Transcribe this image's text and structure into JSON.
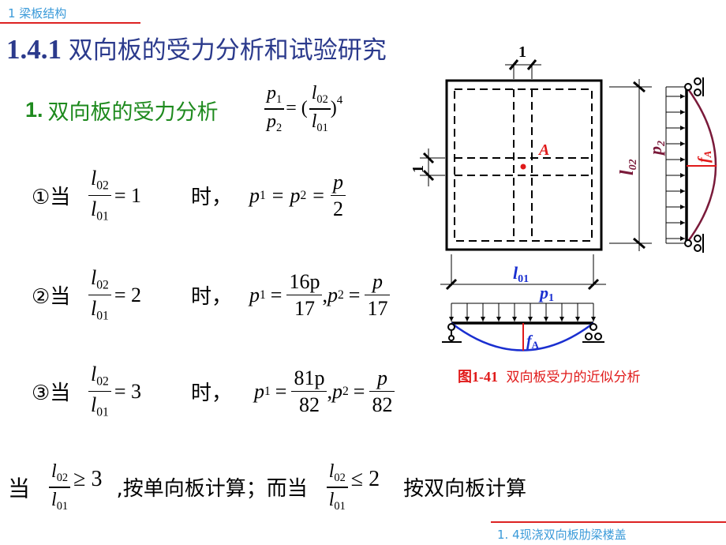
{
  "header": {
    "chapter": "1  梁板结构",
    "title_number": "1.4.1",
    "title_text": "双向板的受力分析和试验研究"
  },
  "section": {
    "number": "1.",
    "label": "双向板的受力分析",
    "formula": {
      "lhs_num": "p",
      "lhs_num_sub": "1",
      "lhs_den": "p",
      "lhs_den_sub": "2",
      "eq": "= (",
      "rhs_num": "l",
      "rhs_num_sub": "02",
      "rhs_den": "l",
      "rhs_den_sub": "01",
      "close": ")",
      "exp": "4"
    }
  },
  "cases": [
    {
      "marker": "①当",
      "ratio_value": "= 1",
      "when": "时，",
      "result": {
        "p1_label": "p",
        "p1_sub": "1",
        "p2_label": "p",
        "p2_sub": "2",
        "p1_num": "p",
        "p1_den": "2",
        "p2_num": "",
        "p2_den": ""
      }
    },
    {
      "marker": "②当",
      "ratio_value": "= 2",
      "when": "时，",
      "result": {
        "p1_label": "p",
        "p1_sub": "1",
        "p2_label": "p",
        "p2_sub": "2",
        "p1_num": "16p",
        "p1_den": "17",
        "p2_num": "p",
        "p2_den": "17"
      }
    },
    {
      "marker": "③当",
      "ratio_value": "= 3",
      "when": "时，",
      "result": {
        "p1_label": "p",
        "p1_sub": "1",
        "p2_label": "p",
        "p2_sub": "2",
        "p1_num": "81p",
        "p1_den": "82",
        "p2_num": "p",
        "p2_den": "82"
      }
    }
  ],
  "ratio": {
    "num": "l",
    "num_sub": "02",
    "den": "l",
    "den_sub": "01"
  },
  "conclusion": {
    "prefix": "当",
    "cond1": "≥ 3",
    "text1": ",按单向板计算；而当",
    "cond2": "≤ 2",
    "text2": "按双向板计算"
  },
  "figure": {
    "strip_width_label": "1",
    "point_label": "A",
    "l02_label": "l",
    "l02_sub": "02",
    "p2_label": "p",
    "p2_sub": "2",
    "fA_label": "f",
    "fA_sub": "A",
    "l01_label": "l",
    "l01_sub": "01",
    "p1_label": "p",
    "p1_sub": "1",
    "caption_num": "图1-41",
    "caption_text": "双向板受力的近似分析",
    "colors": {
      "red": "#e01a1a",
      "blue": "#1a2fd0",
      "maroon": "#7a1a3a"
    }
  },
  "footer": {
    "text": "1. 4现浇双向板肋梁楼盖"
  }
}
